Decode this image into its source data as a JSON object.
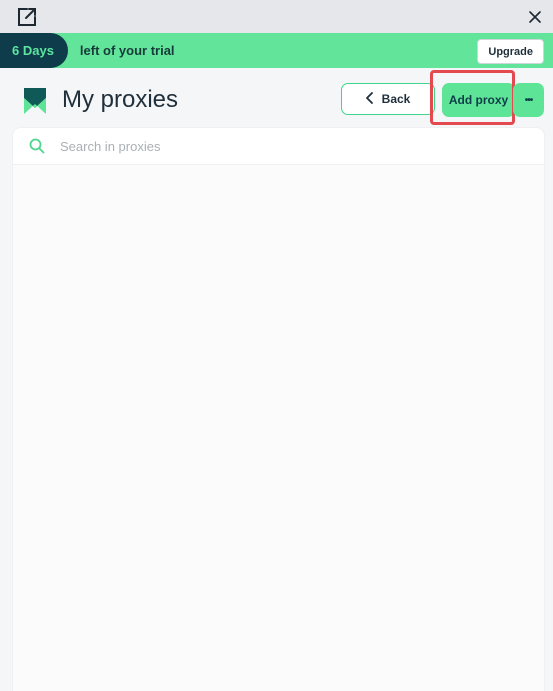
{
  "topbar": {
    "external_icon": "external-link-icon",
    "close_icon": "close-icon"
  },
  "banner": {
    "days": "6 Days",
    "message": "left of your trial",
    "upgrade_label": "Upgrade"
  },
  "header": {
    "title": "My proxies",
    "back_label": "Back",
    "add_proxy_label": "Add proxy",
    "more_label": "•••"
  },
  "search": {
    "placeholder": "Search in proxies"
  },
  "colors": {
    "accent": "#5ee497",
    "banner": "#62e59a",
    "dark": "#0f3c4a",
    "highlight": "#e24a4f"
  }
}
